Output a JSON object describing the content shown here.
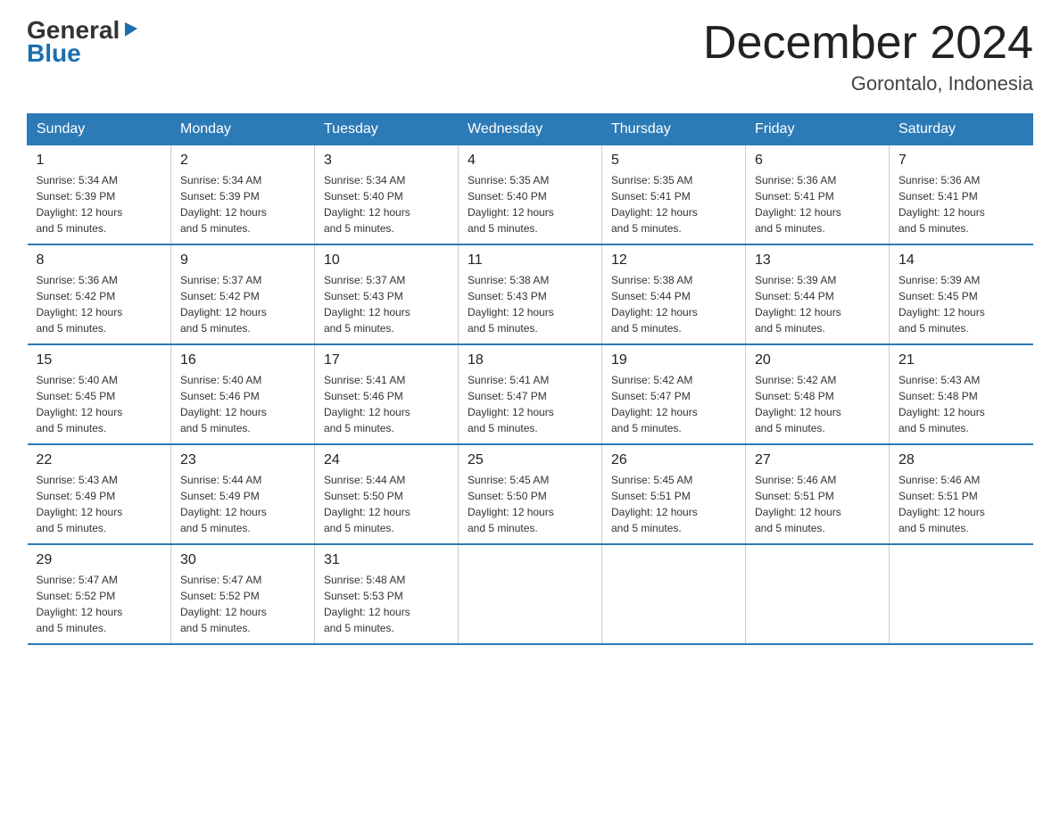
{
  "logo": {
    "text_general": "General",
    "text_blue": "Blue",
    "triangle": "▶"
  },
  "header": {
    "month_title": "December 2024",
    "location": "Gorontalo, Indonesia"
  },
  "days_of_week": [
    "Sunday",
    "Monday",
    "Tuesday",
    "Wednesday",
    "Thursday",
    "Friday",
    "Saturday"
  ],
  "weeks": [
    [
      {
        "day": "1",
        "sunrise": "5:34 AM",
        "sunset": "5:39 PM",
        "daylight": "12 hours and 5 minutes."
      },
      {
        "day": "2",
        "sunrise": "5:34 AM",
        "sunset": "5:39 PM",
        "daylight": "12 hours and 5 minutes."
      },
      {
        "day": "3",
        "sunrise": "5:34 AM",
        "sunset": "5:40 PM",
        "daylight": "12 hours and 5 minutes."
      },
      {
        "day": "4",
        "sunrise": "5:35 AM",
        "sunset": "5:40 PM",
        "daylight": "12 hours and 5 minutes."
      },
      {
        "day": "5",
        "sunrise": "5:35 AM",
        "sunset": "5:41 PM",
        "daylight": "12 hours and 5 minutes."
      },
      {
        "day": "6",
        "sunrise": "5:36 AM",
        "sunset": "5:41 PM",
        "daylight": "12 hours and 5 minutes."
      },
      {
        "day": "7",
        "sunrise": "5:36 AM",
        "sunset": "5:41 PM",
        "daylight": "12 hours and 5 minutes."
      }
    ],
    [
      {
        "day": "8",
        "sunrise": "5:36 AM",
        "sunset": "5:42 PM",
        "daylight": "12 hours and 5 minutes."
      },
      {
        "day": "9",
        "sunrise": "5:37 AM",
        "sunset": "5:42 PM",
        "daylight": "12 hours and 5 minutes."
      },
      {
        "day": "10",
        "sunrise": "5:37 AM",
        "sunset": "5:43 PM",
        "daylight": "12 hours and 5 minutes."
      },
      {
        "day": "11",
        "sunrise": "5:38 AM",
        "sunset": "5:43 PM",
        "daylight": "12 hours and 5 minutes."
      },
      {
        "day": "12",
        "sunrise": "5:38 AM",
        "sunset": "5:44 PM",
        "daylight": "12 hours and 5 minutes."
      },
      {
        "day": "13",
        "sunrise": "5:39 AM",
        "sunset": "5:44 PM",
        "daylight": "12 hours and 5 minutes."
      },
      {
        "day": "14",
        "sunrise": "5:39 AM",
        "sunset": "5:45 PM",
        "daylight": "12 hours and 5 minutes."
      }
    ],
    [
      {
        "day": "15",
        "sunrise": "5:40 AM",
        "sunset": "5:45 PM",
        "daylight": "12 hours and 5 minutes."
      },
      {
        "day": "16",
        "sunrise": "5:40 AM",
        "sunset": "5:46 PM",
        "daylight": "12 hours and 5 minutes."
      },
      {
        "day": "17",
        "sunrise": "5:41 AM",
        "sunset": "5:46 PM",
        "daylight": "12 hours and 5 minutes."
      },
      {
        "day": "18",
        "sunrise": "5:41 AM",
        "sunset": "5:47 PM",
        "daylight": "12 hours and 5 minutes."
      },
      {
        "day": "19",
        "sunrise": "5:42 AM",
        "sunset": "5:47 PM",
        "daylight": "12 hours and 5 minutes."
      },
      {
        "day": "20",
        "sunrise": "5:42 AM",
        "sunset": "5:48 PM",
        "daylight": "12 hours and 5 minutes."
      },
      {
        "day": "21",
        "sunrise": "5:43 AM",
        "sunset": "5:48 PM",
        "daylight": "12 hours and 5 minutes."
      }
    ],
    [
      {
        "day": "22",
        "sunrise": "5:43 AM",
        "sunset": "5:49 PM",
        "daylight": "12 hours and 5 minutes."
      },
      {
        "day": "23",
        "sunrise": "5:44 AM",
        "sunset": "5:49 PM",
        "daylight": "12 hours and 5 minutes."
      },
      {
        "day": "24",
        "sunrise": "5:44 AM",
        "sunset": "5:50 PM",
        "daylight": "12 hours and 5 minutes."
      },
      {
        "day": "25",
        "sunrise": "5:45 AM",
        "sunset": "5:50 PM",
        "daylight": "12 hours and 5 minutes."
      },
      {
        "day": "26",
        "sunrise": "5:45 AM",
        "sunset": "5:51 PM",
        "daylight": "12 hours and 5 minutes."
      },
      {
        "day": "27",
        "sunrise": "5:46 AM",
        "sunset": "5:51 PM",
        "daylight": "12 hours and 5 minutes."
      },
      {
        "day": "28",
        "sunrise": "5:46 AM",
        "sunset": "5:51 PM",
        "daylight": "12 hours and 5 minutes."
      }
    ],
    [
      {
        "day": "29",
        "sunrise": "5:47 AM",
        "sunset": "5:52 PM",
        "daylight": "12 hours and 5 minutes."
      },
      {
        "day": "30",
        "sunrise": "5:47 AM",
        "sunset": "5:52 PM",
        "daylight": "12 hours and 5 minutes."
      },
      {
        "day": "31",
        "sunrise": "5:48 AM",
        "sunset": "5:53 PM",
        "daylight": "12 hours and 5 minutes."
      },
      null,
      null,
      null,
      null
    ]
  ],
  "labels": {
    "sunrise": "Sunrise:",
    "sunset": "Sunset:",
    "daylight": "Daylight:"
  }
}
